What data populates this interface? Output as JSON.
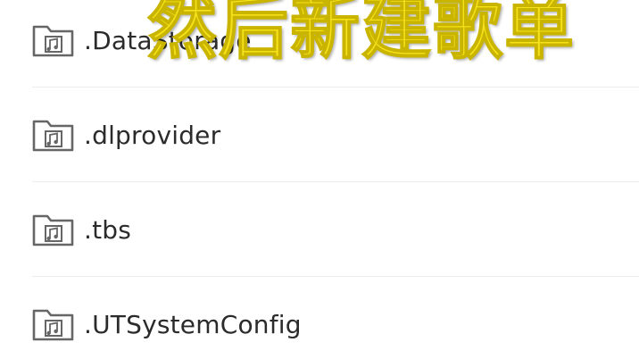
{
  "file_list": {
    "items": [
      {
        "name": ".DataStorage",
        "icon": "music-folder-icon"
      },
      {
        "name": ".dlprovider",
        "icon": "music-folder-icon"
      },
      {
        "name": ".tbs",
        "icon": "music-folder-icon"
      },
      {
        "name": ".UTSystemConfig",
        "icon": "music-folder-icon"
      }
    ]
  },
  "overlay": {
    "caption": "然后新建歌单"
  },
  "colors": {
    "icon": "#666666",
    "text": "#2b2b2b",
    "caption": "#f6e21a",
    "divider": "#ececec"
  }
}
